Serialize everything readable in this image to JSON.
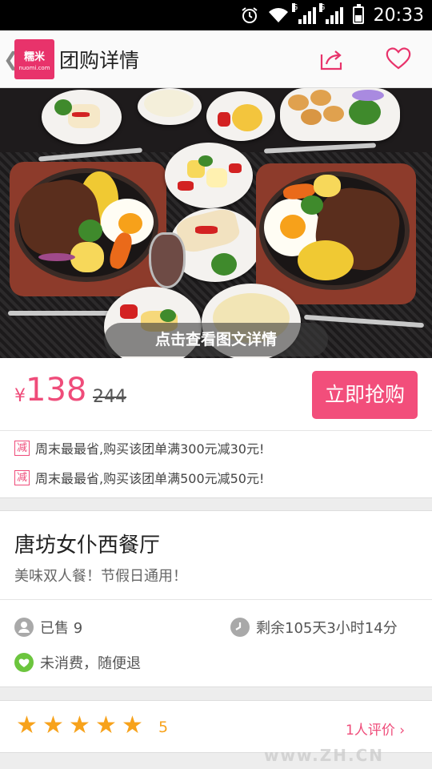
{
  "status_bar": {
    "time": "20:33",
    "network_label_1": "G",
    "network_label_2": "G"
  },
  "header": {
    "logo_text": "糯米",
    "logo_sub": "nuomi.com",
    "title": "团购详情"
  },
  "hero": {
    "caption": "点击查看图文详情"
  },
  "price": {
    "currency": "¥",
    "current": "138",
    "original": "244",
    "buy_label": "立即抢购"
  },
  "promotions": [
    {
      "tag": "减",
      "text": "周末最最省,购买该团单满300元减30元!"
    },
    {
      "tag": "减",
      "text": "周末最最省,购买该团单满500元减50元!"
    }
  ],
  "deal": {
    "name": "唐坊女仆西餐厅",
    "subtitle": "美味双人餐！节假日通用！"
  },
  "info": {
    "sold": "已售 9",
    "remaining": "剩余105天3小时14分",
    "refund": "未消费，随便退"
  },
  "rating": {
    "stars": 5,
    "score": "5",
    "review_link": "1人评价"
  },
  "watermark": "www.ZH.CN",
  "colors": {
    "accent": "#ef4c7a",
    "star": "#f7a21b",
    "refund_icon": "#6cc53e"
  }
}
